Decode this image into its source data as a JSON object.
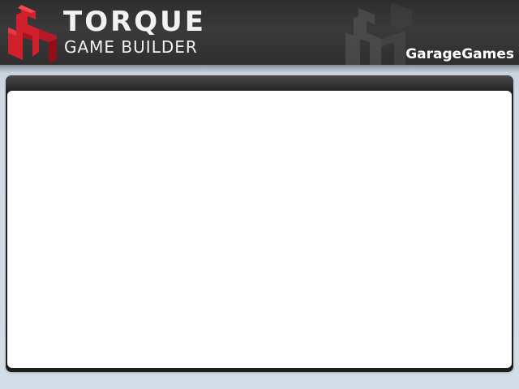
{
  "header": {
    "title": "TORQUE",
    "subtitle": "GAME BUILDER",
    "company": "GarageGames",
    "logo_icon": "torque-logo-icon",
    "watermark_icon": "torque-watermark-icon",
    "brand_color": "#d0202c"
  },
  "panel": {
    "title": "",
    "content": ""
  }
}
